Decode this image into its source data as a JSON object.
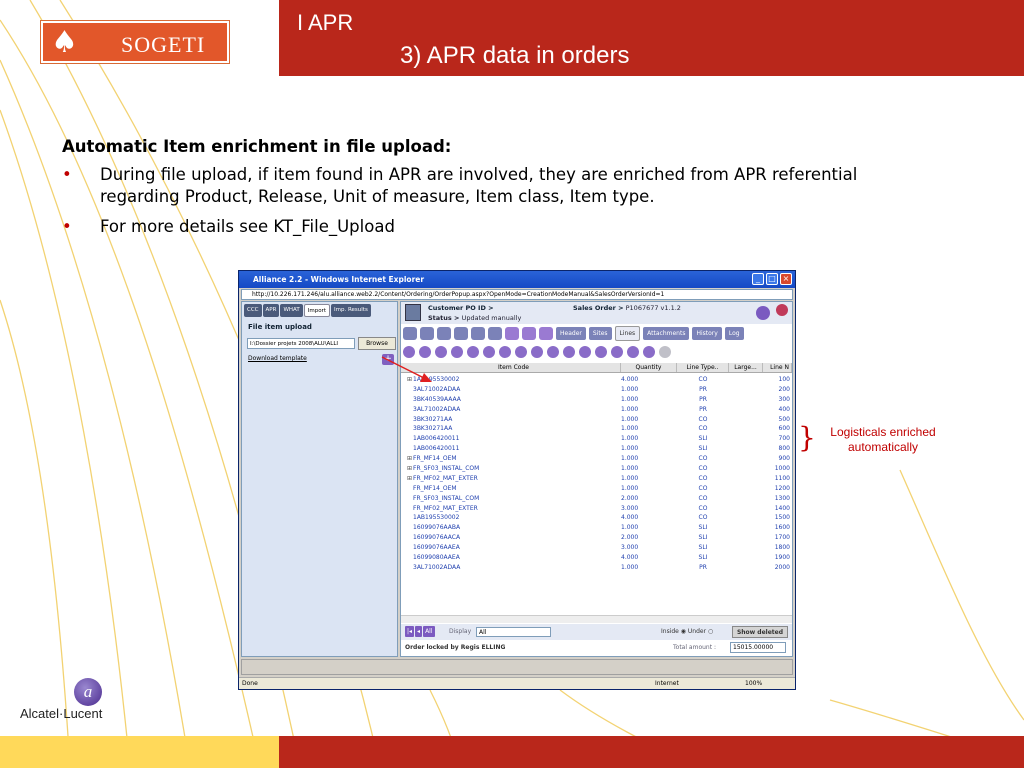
{
  "slide": {
    "title_line1": "I APR",
    "title_line2": "3) APR data in orders",
    "logo_text": "SOGETI",
    "logo_spade": "♠",
    "heading": "Automatic Item enrichment in file upload:",
    "bullet_char": "•",
    "bullets": [
      "During file upload, if item found in APR are involved, they are enriched from APR referential regarding Product, Release, Unit of measure, Item class, Item type.",
      "For more details see KT_File_Upload"
    ],
    "annotation": "Logisticals enriched automatically",
    "brace": "}",
    "footer_logo": "Alcatel·Lucent",
    "footer_logo_mark": "a"
  },
  "browser": {
    "title": "Alliance 2.2 - Windows Internet Explorer",
    "address": "http://10.226.171.246/alu.alliance.web2.2/Content/Ordering/OrderPopup.aspx?OpenMode=CreationModeManual&SalesOrderVersionId=1",
    "status_done": "Done",
    "status_zone": "Internet",
    "status_zoom": "100%",
    "ctrl_min": "_",
    "ctrl_max": "□",
    "ctrl_close": "×"
  },
  "left_panel": {
    "tabs": [
      "CCC",
      "APR",
      "WHAT",
      "Import",
      "Imp. Results"
    ],
    "title": "File item upload",
    "file_value": "I:\\Dossier projets 2008\\ALU\\ALLI",
    "browse_label": "Browse",
    "download_label": "Download template",
    "plus_label": "+"
  },
  "right_panel": {
    "customer_po_label": "Customer PO ID >",
    "status_label": "Status >",
    "status_value": "Updated manually",
    "sales_order_label": "Sales Order >",
    "sales_order_value": "P1067677  v1.1.2",
    "nav_tabs": [
      "Header",
      "Sites",
      "Lines",
      "Attachments",
      "History",
      "Log"
    ],
    "active_tab": "Lines",
    "columns": [
      "Item Code",
      "Quantity",
      "Line Type..",
      "Large...",
      "Line N"
    ],
    "rows": [
      {
        "expand": "⊞",
        "code": "1AB195530002",
        "qty": "4.000",
        "type": "CO",
        "line": "100"
      },
      {
        "expand": "",
        "code": "3AL71002ADAA",
        "qty": "1.000",
        "type": "PR",
        "line": "200"
      },
      {
        "expand": "",
        "code": "3BK40539AAAA",
        "qty": "1.000",
        "type": "PR",
        "line": "300"
      },
      {
        "expand": "",
        "code": "3AL71002ADAA",
        "qty": "1.000",
        "type": "PR",
        "line": "400"
      },
      {
        "expand": "",
        "code": "3BK30271AA",
        "qty": "1.000",
        "type": "CO",
        "line": "500"
      },
      {
        "expand": "",
        "code": "3BK30271AA",
        "qty": "1.000",
        "type": "CO",
        "line": "600"
      },
      {
        "expand": "",
        "code": "1AB006420011",
        "qty": "1.000",
        "type": "SLI",
        "line": "700"
      },
      {
        "expand": "",
        "code": "1AB006420011",
        "qty": "1.000",
        "type": "SLI",
        "line": "800"
      },
      {
        "expand": "⊞",
        "code": "FR_MF14_OEM",
        "qty": "1.000",
        "type": "CO",
        "line": "900"
      },
      {
        "expand": "⊞",
        "code": "FR_SF03_INSTAL_COM",
        "qty": "1.000",
        "type": "CO",
        "line": "1000"
      },
      {
        "expand": "⊞",
        "code": "FR_MF02_MAT_EXTER",
        "qty": "1.000",
        "type": "CO",
        "line": "1100"
      },
      {
        "expand": "",
        "code": "FR_MF14_OEM",
        "qty": "1.000",
        "type": "CO",
        "line": "1200"
      },
      {
        "expand": "",
        "code": "FR_SF03_INSTAL_COM",
        "qty": "2.000",
        "type": "CO",
        "line": "1300"
      },
      {
        "expand": "",
        "code": "FR_MF02_MAT_EXTER",
        "qty": "3.000",
        "type": "CO",
        "line": "1400"
      },
      {
        "expand": "",
        "code": "1AB195530002",
        "qty": "4.000",
        "type": "CO",
        "line": "1500"
      },
      {
        "expand": "",
        "code": "16099076AABA",
        "qty": "1.000",
        "type": "SLI",
        "line": "1600"
      },
      {
        "expand": "",
        "code": "16099076AACA",
        "qty": "2.000",
        "type": "SLI",
        "line": "1700"
      },
      {
        "expand": "",
        "code": "16099076AAEA",
        "qty": "3.000",
        "type": "SLI",
        "line": "1800"
      },
      {
        "expand": "",
        "code": "16099080AAEA",
        "qty": "4.000",
        "type": "SLI",
        "line": "1900"
      },
      {
        "expand": "",
        "code": "3AL71002ADAA",
        "qty": "1.000",
        "type": "PR",
        "line": "2000"
      }
    ],
    "nav_buttons": [
      "|◂",
      "◂",
      "All"
    ],
    "display_label": "Display",
    "display_value": "All",
    "inside_under_label": "Inside ◉  Under ○",
    "show_deleted_label": "Show deleted",
    "locked_text": "Order locked by Regis ELLING",
    "total_label": "Total amount :",
    "total_value": "15015.00000"
  },
  "colors": {
    "header_red": "#b9271b",
    "logo_orange": "#e2572a",
    "annotation_red": "#c00000",
    "footer_yellow": "#ffd95a"
  }
}
